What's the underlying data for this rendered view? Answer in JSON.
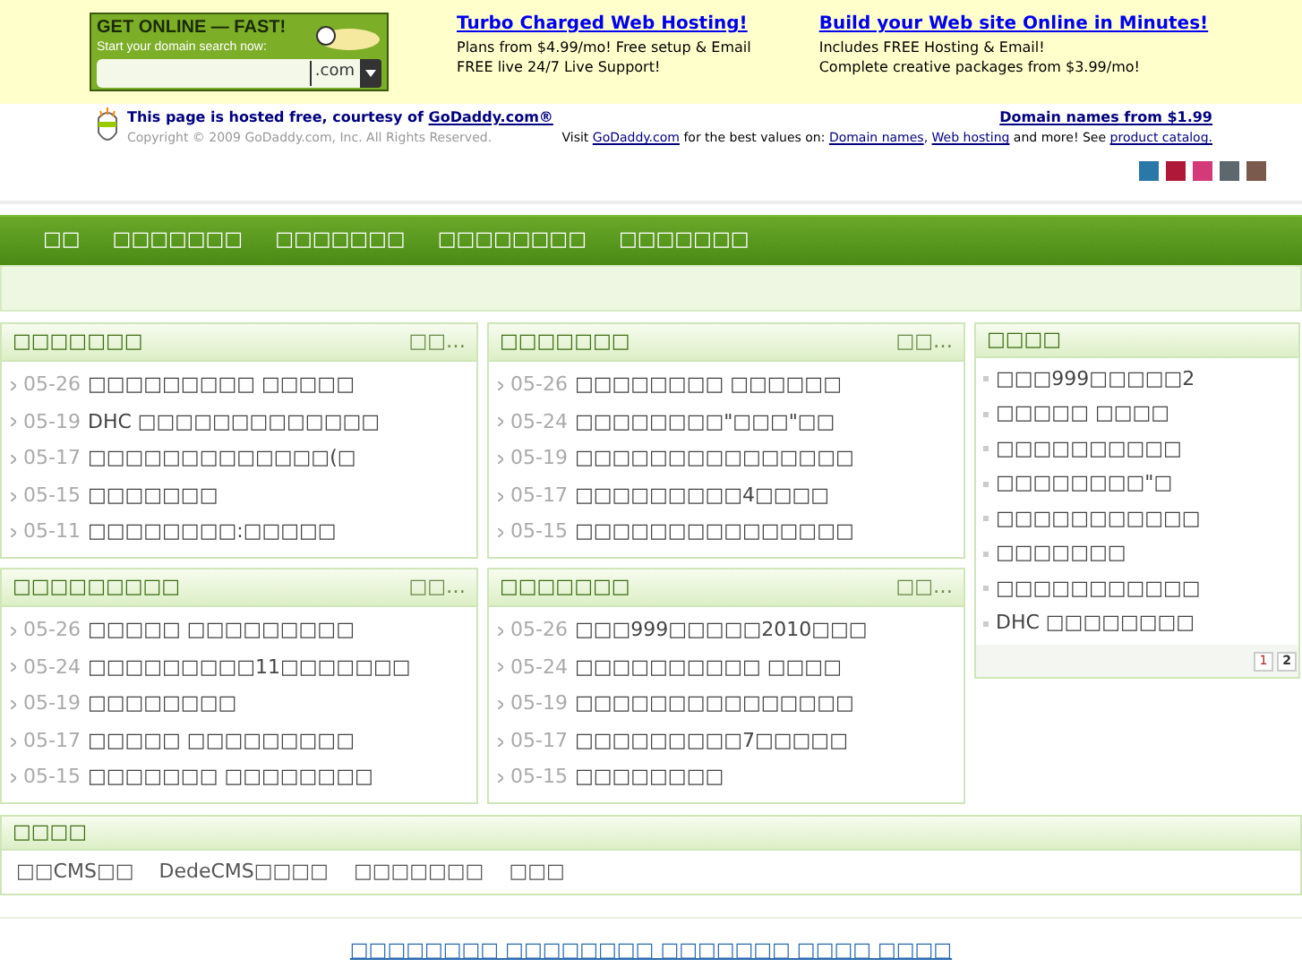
{
  "ad": {
    "headline": "GET ONLINE — FAST!",
    "subline": "Start your domain search now:",
    "domain_suffix": ".com",
    "offers": [
      {
        "title": "Turbo Charged Web Hosting!",
        "lines": [
          "Plans from $4.99/mo! Free setup & Email",
          "FREE live 24/7 Live Support!"
        ]
      },
      {
        "title": "Build your Web site Online in Minutes!",
        "lines": [
          "Includes FREE Hosting & Email!",
          "Complete creative packages from $3.99/mo!"
        ]
      }
    ]
  },
  "hosted": {
    "message": "This page is hosted free, courtesy of ",
    "brand_link": "GoDaddy.com®",
    "copyright": "Copyright ©  2009 GoDaddy.com, Inc. All Rights Reserved.",
    "domain_link": "Domain names from $1.99",
    "visit_parts": [
      {
        "kind": "text",
        "text": "Visit "
      },
      {
        "kind": "link",
        "text": "GoDaddy.com"
      },
      {
        "kind": "text",
        "text": " for the best values on: "
      },
      {
        "kind": "link",
        "text": "Domain names",
        "after": ", "
      },
      {
        "kind": "link",
        "text": "Web hosting"
      },
      {
        "kind": "text",
        "text": " and more! See "
      },
      {
        "kind": "link",
        "text": "product catalog."
      }
    ]
  },
  "themes": [
    {
      "color": "#2a78a8"
    },
    {
      "color": "#b0183a"
    },
    {
      "color": "#d43a78"
    },
    {
      "color": "#5c676e"
    },
    {
      "color": "#7a5a4c"
    }
  ],
  "nav": [
    "□□",
    "□□□□□□□",
    "□□□□□□□",
    "□□□□□□□□",
    "□□□□□□□"
  ],
  "panels": [
    {
      "title": "□□□□□□□",
      "more": "□□…",
      "items": [
        {
          "date": "05-26",
          "title": "□□□□□□□□□ □□□□□"
        },
        {
          "date": "05-19",
          "title": "DHC □□□□□□□□□□□□□"
        },
        {
          "date": "05-17",
          "title": "□□□□□□□□□□□□□(□"
        },
        {
          "date": "05-15",
          "title": "□□□□□□□"
        },
        {
          "date": "05-11",
          "title": "□□□□□□□□:□□□□□"
        }
      ]
    },
    {
      "title": "□□□□□□□",
      "more": "□□…",
      "items": [
        {
          "date": "05-26",
          "title": "□□□□□□□□ □□□□□□"
        },
        {
          "date": "05-24",
          "title": "□□□□□□□□\"□□□\"□□"
        },
        {
          "date": "05-19",
          "title": "□□□□□□□□□□□□□□□"
        },
        {
          "date": "05-17",
          "title": "□□□□□□□□□4□□□□"
        },
        {
          "date": "05-15",
          "title": "□□□□□□□□□□□□□□□"
        }
      ]
    },
    {
      "title": "□□□□□□□□□",
      "more": "□□…",
      "items": [
        {
          "date": "05-26",
          "title": "□□□□□ □□□□□□□□□"
        },
        {
          "date": "05-24",
          "title": "□□□□□□□□□11□□□□□□□"
        },
        {
          "date": "05-19",
          "title": "□□□□□□□□"
        },
        {
          "date": "05-17",
          "title": "□□□□□ □□□□□□□□□"
        },
        {
          "date": "05-15",
          "title": "□□□□□□□ □□□□□□□□"
        }
      ]
    },
    {
      "title": "□□□□□□□",
      "more": "□□…",
      "items": [
        {
          "date": "05-26",
          "title": "□□□999□□□□□2010□□□"
        },
        {
          "date": "05-24",
          "title": "□□□□□□□□□□ □□□□"
        },
        {
          "date": "05-19",
          "title": "□□□□□□□□□□□□□□□"
        },
        {
          "date": "05-17",
          "title": "□□□□□□□□□7□□□□□"
        },
        {
          "date": "05-15",
          "title": "□□□□□□□□"
        }
      ]
    }
  ],
  "side": {
    "title": "□□□□",
    "items": [
      "□□□999□□□□□2",
      "□□□□□ □□□□",
      "□□□□□□□□□□",
      "□□□□□□□□\"□",
      "□□□□□□□□□□□",
      "□□□□□□□",
      "□□□□□□□□□□□",
      "DHC □□□□□□□□"
    ],
    "pages": [
      {
        "label": "1",
        "selected": true
      },
      {
        "label": "2",
        "selected": false
      }
    ]
  },
  "links": {
    "title": "□□□□",
    "items": [
      "□□CMS□□",
      "DedeCMS□□□□",
      "□□□□□□□",
      "□□□"
    ]
  },
  "footer": "□□□□□□□□ □□□□□□□□ □□□□□□□ □□□□ □□□□"
}
